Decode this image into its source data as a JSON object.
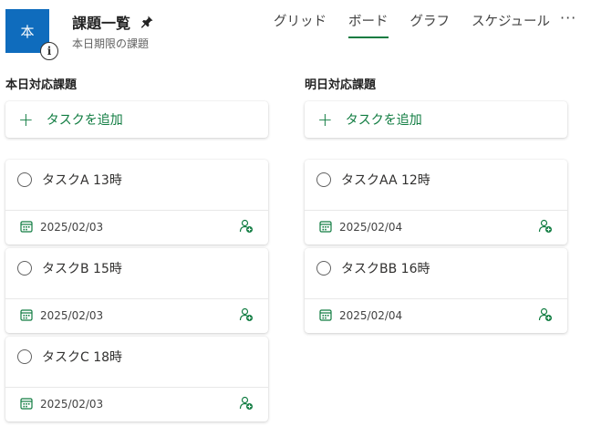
{
  "header": {
    "plan_icon_letter": "本",
    "info_icon": "info-icon",
    "title": "課題一覧",
    "pin_icon": "pin-icon",
    "subtitle": "本日期限の課題",
    "more_label": "···"
  },
  "tabs": [
    {
      "label": "グリッド",
      "active": false
    },
    {
      "label": "ボード",
      "active": true
    },
    {
      "label": "グラフ",
      "active": false
    },
    {
      "label": "スケジュール",
      "active": false
    }
  ],
  "colors": {
    "accent": "#107c41",
    "plan_icon_bg": "#0f6cbd"
  },
  "buckets": [
    {
      "title": "本日対応課題",
      "add_task_label": "タスクを追加",
      "tasks": [
        {
          "name": "タスクA 13時",
          "due": "2025/02/03"
        },
        {
          "name": "タスクB 15時",
          "due": "2025/02/03"
        },
        {
          "name": "タスクC 18時",
          "due": "2025/02/03"
        }
      ]
    },
    {
      "title": "明日対応課題",
      "add_task_label": "タスクを追加",
      "tasks": [
        {
          "name": "タスクAA 12時",
          "due": "2025/02/04"
        },
        {
          "name": "タスクBB 16時",
          "due": "2025/02/04"
        }
      ]
    }
  ]
}
